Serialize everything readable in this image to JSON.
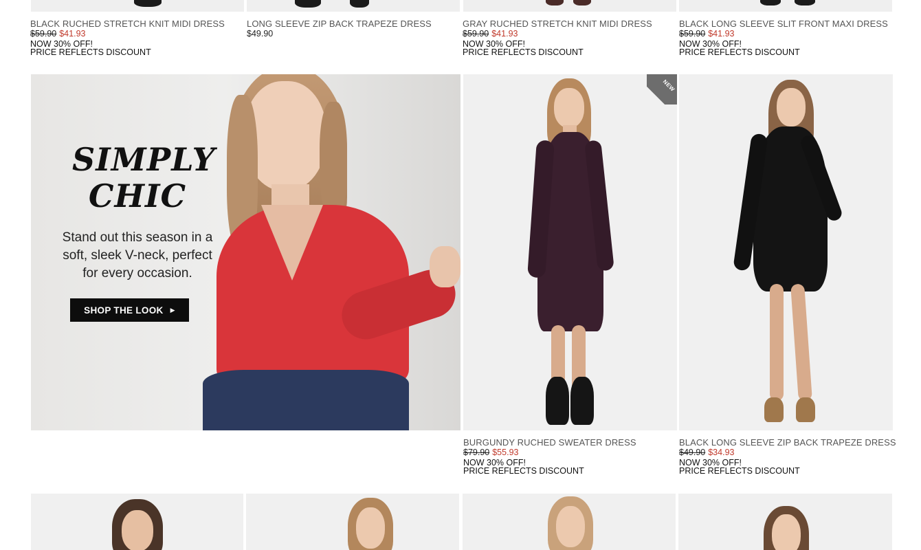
{
  "top_row": [
    {
      "name": "BLACK RUCHED STRETCH KNIT MIDI DRESS",
      "was": "$59.90",
      "now": "$41.93",
      "promo1": "NOW 30% OFF!",
      "promo2": "PRICE REFLECTS DISCOUNT"
    },
    {
      "name": "LONG SLEEVE ZIP BACK TRAPEZE DRESS",
      "regular": "$49.90"
    },
    {
      "name": "GRAY RUCHED STRETCH KNIT MIDI DRESS",
      "was": "$59.90",
      "now": "$41.93",
      "promo1": "NOW 30% OFF!",
      "promo2": "PRICE REFLECTS DISCOUNT"
    },
    {
      "name": "BLACK LONG SLEEVE SLIT FRONT MAXI DRESS",
      "was": "$59.90",
      "now": "$41.93",
      "promo1": "NOW 30% OFF!",
      "promo2": "PRICE REFLECTS DISCOUNT"
    }
  ],
  "banner": {
    "title_line1": "SIMPLY",
    "title_line2": "CHIC",
    "sub_line1": "Stand out this season in a",
    "sub_line2": "soft, sleek V-neck, perfect",
    "sub_line3": "for every occasion.",
    "button": "SHOP THE LOOK",
    "button_icon": "caret-right-icon"
  },
  "middle_row": [
    {
      "name": "BURGUNDY RUCHED SWEATER DRESS",
      "was": "$79.90",
      "now": "$55.93",
      "promo1": "NOW 30% OFF!",
      "promo2": "PRICE REFLECTS DISCOUNT",
      "badge": "NEW"
    },
    {
      "name": "BLACK LONG SLEEVE ZIP BACK TRAPEZE DRESS",
      "was": "$49.90",
      "now": "$34.93",
      "promo1": "NOW 30% OFF!",
      "promo2": "PRICE REFLECTS DISCOUNT"
    }
  ],
  "colors": {
    "sale_price": "#c0392b",
    "button_bg": "#0d0d0d",
    "sweater_red": "#d9353a",
    "burgundy": "#3a1f2e"
  }
}
